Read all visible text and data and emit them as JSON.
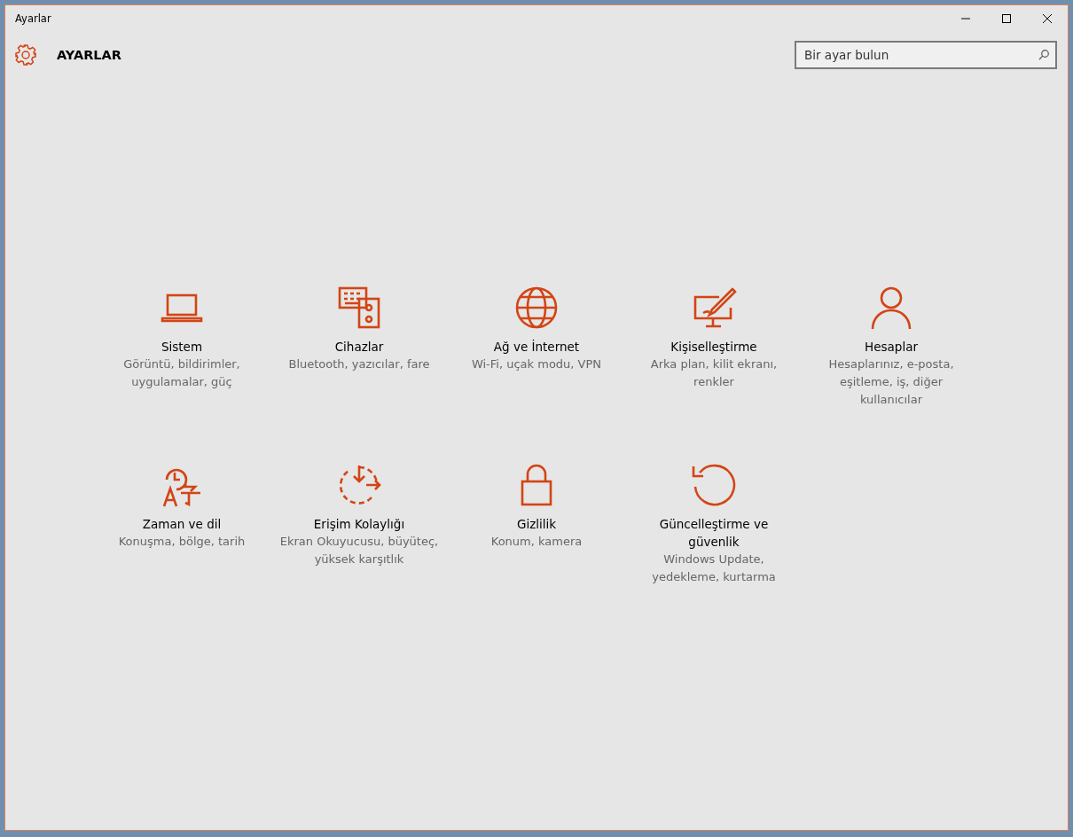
{
  "window": {
    "title": "Ayarlar"
  },
  "header": {
    "title": "AYARLAR",
    "search": {
      "placeholder": "Bir ayar bulun"
    }
  },
  "categories": [
    {
      "title": "Sistem",
      "description": "Görüntü, bildirimler, uygulamalar, güç"
    },
    {
      "title": "Cihazlar",
      "description": "Bluetooth, yazıcılar, fare"
    },
    {
      "title": "Ağ ve İnternet",
      "description": "Wi-Fi, uçak modu, VPN"
    },
    {
      "title": "Kişiselleştirme",
      "description": "Arka plan, kilit ekranı, renkler"
    },
    {
      "title": "Hesaplar",
      "description": "Hesaplarınız, e-posta, eşitleme, iş, diğer kullanıcılar"
    },
    {
      "title": "Zaman ve dil",
      "description": "Konuşma, bölge, tarih"
    },
    {
      "title": "Erişim Kolaylığı",
      "description": "Ekran Okuyucusu, büyüteç, yüksek karşıtlık"
    },
    {
      "title": "Gizlilik",
      "description": "Konum, kamera"
    },
    {
      "title": "Güncelleştirme ve güvenlik",
      "description": "Windows Update, yedekleme, kurtarma"
    }
  ]
}
